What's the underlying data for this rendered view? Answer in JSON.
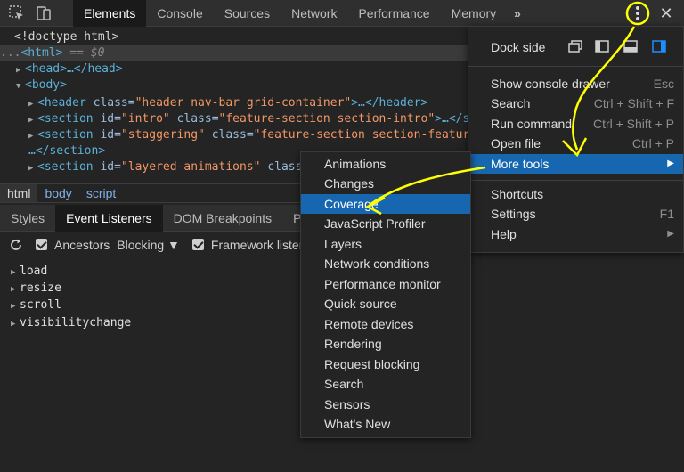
{
  "topbar": {
    "tabs": [
      "Elements",
      "Console",
      "Sources",
      "Network",
      "Performance",
      "Memory"
    ],
    "active_tab": "Elements",
    "overflow_label": "»",
    "close_label": "✕"
  },
  "dom": {
    "doctype": "<!doctype html>",
    "html_open": "<html>",
    "html_dollar": "== $0",
    "html_prefix": "...",
    "head": "<head>…</head>",
    "body_open": "<body>",
    "header_tag": "<header",
    "header_attr": "class=",
    "header_val": "\"header nav-bar grid-container\"",
    "header_end": ">…</header>",
    "sec1_tag": "<section",
    "sec1_id_attr": "id=",
    "sec1_id_val": "\"intro\"",
    "sec1_class_attr": "class=",
    "sec1_class_val": "\"feature-section section-intro\"",
    "sec1_end": ">…</sec",
    "sec2_tag": "<section",
    "sec2_id_attr": "id=",
    "sec2_id_val": "\"staggering\"",
    "sec2_class_attr": "class=",
    "sec2_class_val": "\"feature-section section-feature",
    "sec2_close": "…</section>",
    "sec3_tag": "<section",
    "sec3_id_attr": "id=",
    "sec3_id_val": "\"layered-animations\"",
    "sec3_class_attr": "class="
  },
  "breadcrumbs": [
    "html",
    "body",
    "script"
  ],
  "subtabs": [
    "Styles",
    "Event Listeners",
    "DOM Breakpoints",
    "Prop"
  ],
  "active_subtab": "Event Listeners",
  "toolbar": {
    "ancestors": "Ancestors",
    "blocking": "Blocking ▼",
    "framework": "Framework listen"
  },
  "events": [
    "load",
    "resize",
    "scroll",
    "visibilitychange"
  ],
  "main_menu": {
    "dock_side": "Dock side",
    "items": [
      {
        "label": "Show console drawer",
        "shortcut": "Esc"
      },
      {
        "label": "Search",
        "shortcut": "Ctrl + Shift + F"
      },
      {
        "label": "Run command",
        "shortcut": "Ctrl + Shift + P"
      },
      {
        "label": "Open file",
        "shortcut": "Ctrl + P"
      },
      {
        "label": "More tools",
        "shortcut": "▶"
      }
    ],
    "items2": [
      {
        "label": "Shortcuts",
        "shortcut": ""
      },
      {
        "label": "Settings",
        "shortcut": "F1"
      },
      {
        "label": "Help",
        "shortcut": "▶"
      }
    ],
    "highlighted": "More tools"
  },
  "more_tools": {
    "items": [
      "Animations",
      "Changes",
      "Coverage",
      "JavaScript Profiler",
      "Layers",
      "Network conditions",
      "Performance monitor",
      "Quick source",
      "Remote devices",
      "Rendering",
      "Request blocking",
      "Search",
      "Sensors",
      "What's New"
    ],
    "highlighted": "Coverage"
  },
  "colors": {
    "highlight": "#1766b0",
    "annotation": "#ffff00",
    "background": "#242424"
  },
  "icons": [
    "inspect-icon",
    "device-toolbar-icon",
    "kebab-menu-icon",
    "close-icon",
    "refresh-icon",
    "dock-undock-icon",
    "dock-left-icon",
    "dock-bottom-icon",
    "dock-right-icon",
    "submenu-arrow-icon"
  ]
}
